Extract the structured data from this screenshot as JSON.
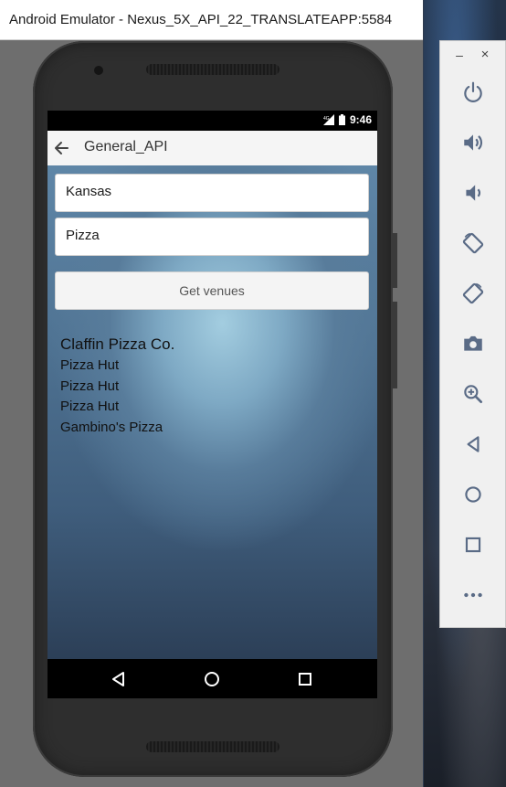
{
  "window": {
    "title": "Android Emulator - Nexus_5X_API_22_TRANSLATEAPP:5584"
  },
  "status_bar": {
    "time": "9:46",
    "network": "4G"
  },
  "app_bar": {
    "title": "General_API"
  },
  "form": {
    "city_value": "Kansas",
    "food_value": "Pizza",
    "button_label": "Get venues"
  },
  "venues": [
    "Claffin Pizza Co.",
    "Pizza Hut",
    "Pizza Hut",
    "Pizza Hut",
    "Gambino's Pizza"
  ],
  "toolbar": {
    "minimize": "–",
    "close": "×",
    "icons": [
      "power-icon",
      "volume-up-icon",
      "volume-down-icon",
      "rotate-left-icon",
      "rotate-right-icon",
      "camera-icon",
      "zoom-icon",
      "back-icon",
      "home-icon",
      "overview-icon",
      "more-icon"
    ]
  },
  "colors": {
    "toolbar_icon": "#5a6b86",
    "app_bar_bg": "#f5f5f5",
    "window_bg": "#6e6e6e"
  }
}
